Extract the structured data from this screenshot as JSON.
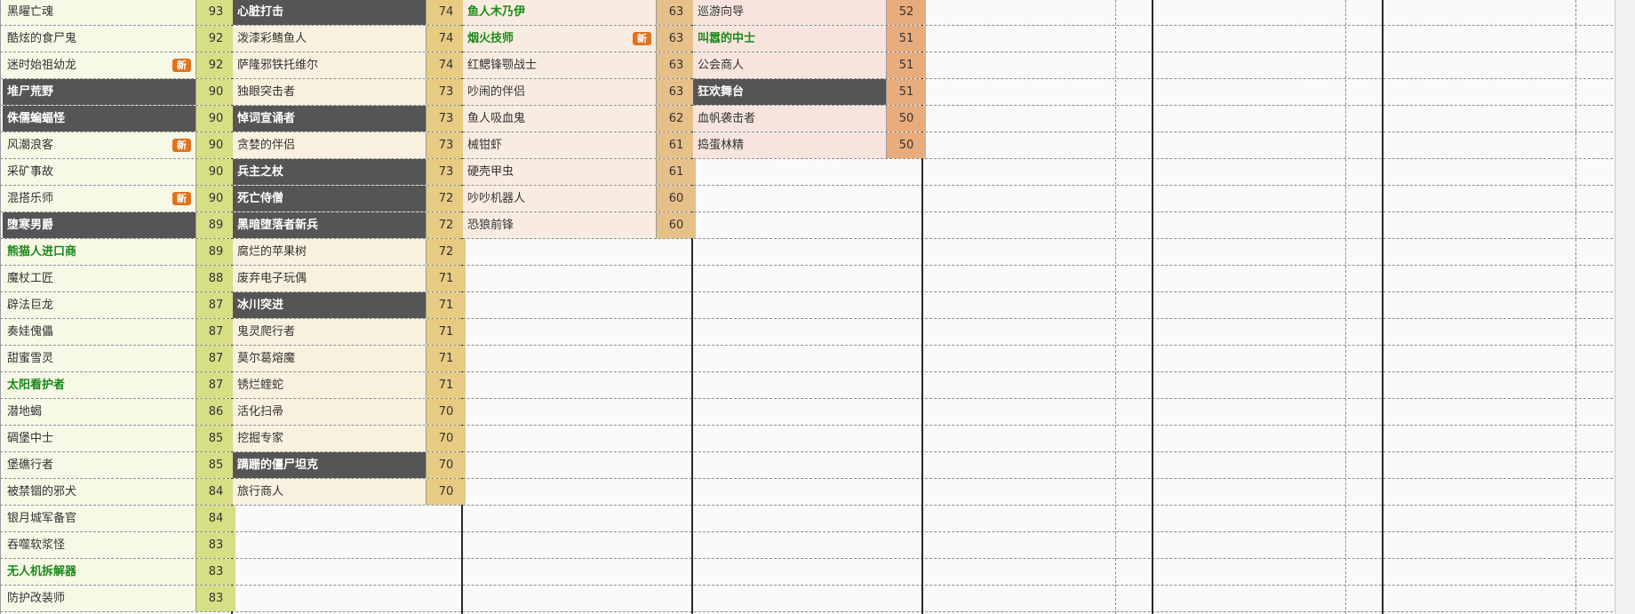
{
  "sheet": {
    "new_badge_label": "新",
    "colors": {
      "dark_row_bg": "#555555",
      "green_text": "#1a8a1a",
      "badge_bg": "#e0731c",
      "col1_score_bg": "#d6df84",
      "col2_score_bg": "#e7cb82",
      "col3_score_bg": "#e6c089",
      "col4_score_bg": "#e8ac7c"
    },
    "columns": [
      {
        "rows": [
          {
            "name": "黑曜亡魂",
            "score": "93",
            "style": "normal",
            "new": false
          },
          {
            "name": "酷炫的食尸鬼",
            "score": "92",
            "style": "normal",
            "new": false
          },
          {
            "name": "迷时始祖幼龙",
            "score": "92",
            "style": "normal",
            "new": true
          },
          {
            "name": "堆尸荒野",
            "score": "90",
            "style": "dark",
            "new": false
          },
          {
            "name": "侏儒蝙蝠怪",
            "score": "90",
            "style": "dark",
            "new": false
          },
          {
            "name": "风潮浪客",
            "score": "90",
            "style": "normal",
            "new": true
          },
          {
            "name": "采矿事故",
            "score": "90",
            "style": "normal",
            "new": false
          },
          {
            "name": "混搭乐师",
            "score": "90",
            "style": "normal",
            "new": true
          },
          {
            "name": "堕寒男爵",
            "score": "89",
            "style": "dark",
            "new": false
          },
          {
            "name": "熊猫人进口商",
            "score": "89",
            "style": "green",
            "new": false
          },
          {
            "name": "魔杖工匠",
            "score": "88",
            "style": "normal",
            "new": false
          },
          {
            "name": "辟法巨龙",
            "score": "87",
            "style": "normal",
            "new": false
          },
          {
            "name": "奏娃傀儡",
            "score": "87",
            "style": "normal",
            "new": false
          },
          {
            "name": "甜蜜雪灵",
            "score": "87",
            "style": "normal",
            "new": false
          },
          {
            "name": "太阳看护者",
            "score": "87",
            "style": "green",
            "new": false
          },
          {
            "name": "潜地蝎",
            "score": "86",
            "style": "normal",
            "new": false
          },
          {
            "name": "碉堡中士",
            "score": "85",
            "style": "normal",
            "new": false
          },
          {
            "name": "堡礁行者",
            "score": "85",
            "style": "normal",
            "new": false
          },
          {
            "name": "被禁锢的邪犬",
            "score": "84",
            "style": "normal",
            "new": false
          },
          {
            "name": "银月城军备官",
            "score": "84",
            "style": "normal",
            "new": false
          },
          {
            "name": "吞噬软浆怪",
            "score": "83",
            "style": "normal",
            "new": false
          },
          {
            "name": "无人机拆解器",
            "score": "83",
            "style": "green",
            "new": false
          },
          {
            "name": "防护改装师",
            "score": "83",
            "style": "normal",
            "new": false
          }
        ]
      },
      {
        "rows": [
          {
            "name": "心脏打击",
            "score": "74",
            "style": "dark",
            "new": false
          },
          {
            "name": "泼漆彩鳍鱼人",
            "score": "74",
            "style": "normal",
            "new": false
          },
          {
            "name": "萨隆邪铁托维尔",
            "score": "74",
            "style": "normal",
            "new": false
          },
          {
            "name": "独眼突击者",
            "score": "73",
            "style": "normal",
            "new": false
          },
          {
            "name": "悼词宣诵者",
            "score": "73",
            "style": "dark",
            "new": false
          },
          {
            "name": "贪婪的伴侣",
            "score": "73",
            "style": "normal",
            "new": false
          },
          {
            "name": "兵主之杖",
            "score": "73",
            "style": "dark",
            "new": false
          },
          {
            "name": "死亡侍僧",
            "score": "72",
            "style": "dark",
            "new": false
          },
          {
            "name": "黑暗堕落者新兵",
            "score": "72",
            "style": "dark",
            "new": false
          },
          {
            "name": "腐烂的苹果树",
            "score": "72",
            "style": "normal",
            "new": false
          },
          {
            "name": "废弃电子玩偶",
            "score": "71",
            "style": "normal",
            "new": false
          },
          {
            "name": "冰川突进",
            "score": "71",
            "style": "dark",
            "new": false
          },
          {
            "name": "鬼灵爬行者",
            "score": "71",
            "style": "normal",
            "new": false
          },
          {
            "name": "莫尔葛熔魔",
            "score": "71",
            "style": "normal",
            "new": false
          },
          {
            "name": "锈烂蝰蛇",
            "score": "71",
            "style": "normal",
            "new": false
          },
          {
            "name": "活化扫帚",
            "score": "70",
            "style": "normal",
            "new": false
          },
          {
            "name": "挖掘专家",
            "score": "70",
            "style": "normal",
            "new": false
          },
          {
            "name": "蹒跚的僵尸坦克",
            "score": "70",
            "style": "dark",
            "new": false
          },
          {
            "name": "旅行商人",
            "score": "70",
            "style": "normal",
            "new": false
          }
        ]
      },
      {
        "rows": [
          {
            "name": "鱼人木乃伊",
            "score": "63",
            "style": "green",
            "new": false
          },
          {
            "name": "烟火技师",
            "score": "63",
            "style": "green",
            "new": true
          },
          {
            "name": "红鳃锋颚战士",
            "score": "63",
            "style": "normal",
            "new": false
          },
          {
            "name": "吵闹的伴侣",
            "score": "63",
            "style": "normal",
            "new": false
          },
          {
            "name": "鱼人吸血鬼",
            "score": "62",
            "style": "normal",
            "new": false
          },
          {
            "name": "械钳虾",
            "score": "61",
            "style": "normal",
            "new": false
          },
          {
            "name": "硬壳甲虫",
            "score": "61",
            "style": "normal",
            "new": false
          },
          {
            "name": "吵吵机器人",
            "score": "60",
            "style": "normal",
            "new": false
          },
          {
            "name": "恐狼前锋",
            "score": "60",
            "style": "normal",
            "new": false
          }
        ]
      },
      {
        "rows": [
          {
            "name": "巡游向导",
            "score": "52",
            "style": "normal",
            "new": false
          },
          {
            "name": "叫嚣的中士",
            "score": "51",
            "style": "green",
            "new": false
          },
          {
            "name": "公会商人",
            "score": "51",
            "style": "normal",
            "new": false
          },
          {
            "name": "狂欢舞台",
            "score": "51",
            "style": "dark",
            "new": false
          },
          {
            "name": "血帆袭击者",
            "score": "50",
            "style": "normal",
            "new": false
          },
          {
            "name": "捣蛋林精",
            "score": "50",
            "style": "normal",
            "new": false
          }
        ]
      }
    ]
  }
}
